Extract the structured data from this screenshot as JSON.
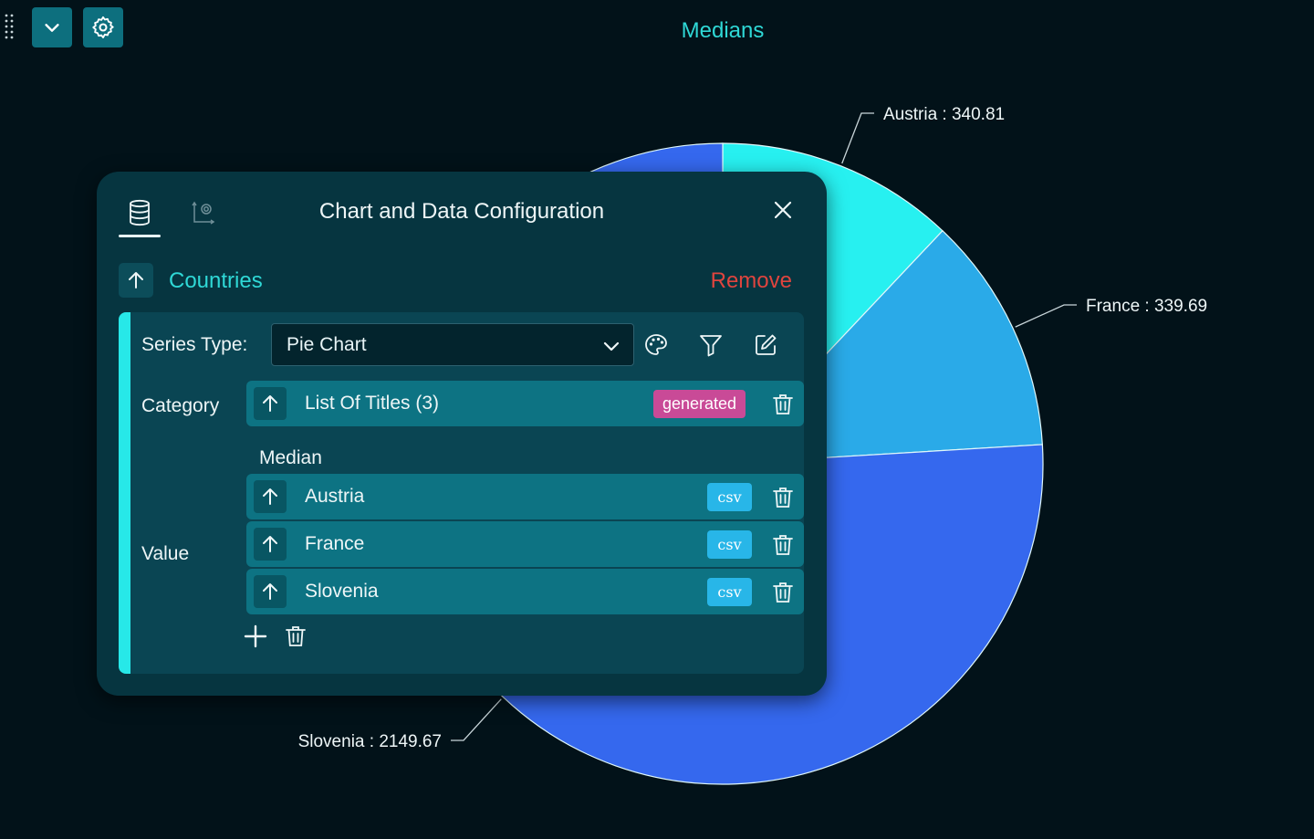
{
  "toolbar": {
    "drag_icon": "drag-grip-icon",
    "collapse_icon": "chevron-down-icon",
    "settings_icon": "gear-icon",
    "button_color": "#0d6f7e"
  },
  "chart_data": {
    "type": "pie",
    "title": "Medians",
    "series": [
      {
        "name": "Median",
        "categories": [
          "Austria",
          "France",
          "Slovenia"
        ],
        "values": [
          340.81,
          339.69,
          2149.67
        ]
      }
    ],
    "labels": [
      "Austria : 340.81",
      "France : 339.69",
      "Slovenia : 2149.67"
    ],
    "colors": [
      "#27f0f0",
      "#2aaae8",
      "#3568ee"
    ],
    "legend": "none"
  },
  "panel": {
    "title": "Chart and Data Configuration",
    "tabs": [
      {
        "icon": "database-icon",
        "active": true
      },
      {
        "icon": "chart-settings-icon",
        "active": false
      }
    ],
    "close_icon": "close-icon",
    "series": {
      "name": "Countries",
      "remove_label": "Remove",
      "series_type_label": "Series Type",
      "series_type_colon": ":",
      "series_type_value": "Pie Chart",
      "tools": [
        "palette-icon",
        "filter-icon",
        "edit-icon"
      ],
      "category_label": "Category",
      "category_row": {
        "text": "List Of Titles (3)",
        "badge": "generated"
      },
      "value_label": "Value",
      "value_group_label": "Median",
      "value_rows": [
        {
          "text": "Austria",
          "badge": "csv"
        },
        {
          "text": "France",
          "badge": "csv"
        },
        {
          "text": "Slovenia",
          "badge": "csv"
        }
      ]
    }
  }
}
